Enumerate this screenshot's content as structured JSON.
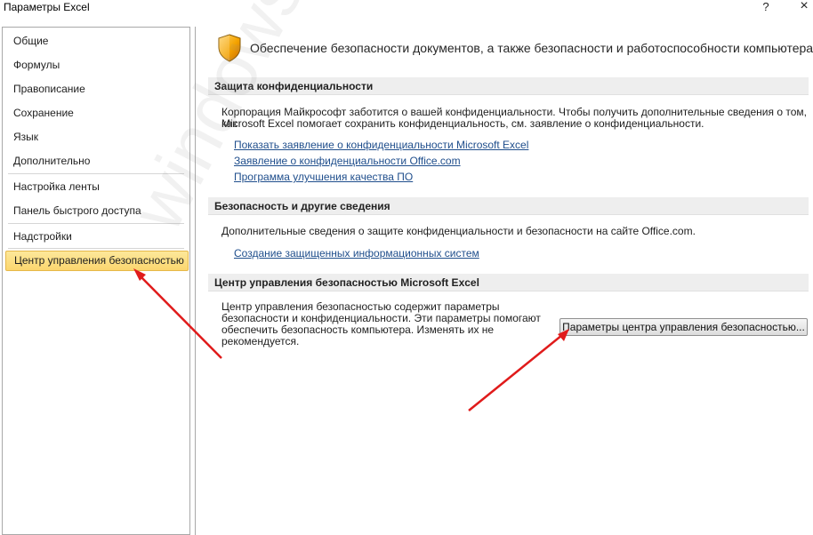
{
  "window": {
    "title": "Параметры Excel",
    "help_glyph": "?",
    "close_glyph": "×"
  },
  "sidebar": {
    "items": [
      {
        "label": "Общие"
      },
      {
        "label": "Формулы"
      },
      {
        "label": "Правописание"
      },
      {
        "label": "Сохранение"
      },
      {
        "label": "Язык"
      },
      {
        "label": "Дополнительно"
      },
      {
        "label": "Настройка ленты"
      },
      {
        "label": "Панель быстрого доступа"
      },
      {
        "label": "Надстройки"
      },
      {
        "label": "Центр управления безопасностью"
      }
    ],
    "active_index": 9
  },
  "main": {
    "header_text": "Обеспечение безопасности документов, а также безопасности и работоспособности компьютера.",
    "privacy": {
      "title": "Защита конфиденциальности",
      "text_line1": "Корпорация Майкрософт заботится о вашей конфиденциальности. Чтобы получить дополнительные сведения о том, как",
      "text_line2": "Microsoft Excel помогает сохранить конфиденциальность, см. заявление о конфиденциальности.",
      "links": [
        "Показать заявление о конфиденциальности Microsoft Excel",
        "Заявление о конфиденциальности Office.com",
        "Программа улучшения качества ПО"
      ]
    },
    "security": {
      "title": "Безопасность и другие сведения",
      "text": "Дополнительные сведения о защите конфиденциальности и безопасности на сайте Office.com.",
      "link": "Создание защищенных информационных систем"
    },
    "trust_center": {
      "title": "Центр управления безопасностью Microsoft Excel",
      "text_line1": "Центр управления безопасностью содержит параметры",
      "text_line2": "безопасности и конфиденциальности. Эти параметры помогают",
      "text_line3": "обеспечить безопасность компьютера. Изменять их не",
      "text_line4": "рекомендуется.",
      "button_label": "Параметры центра управления безопасностью..."
    }
  },
  "watermark": "windowstips.ru",
  "colors": {
    "active_item": "#fbd66f",
    "link": "#1f4e8c",
    "arrow": "#e01b1b",
    "section_header_bg": "#eeeeee"
  }
}
